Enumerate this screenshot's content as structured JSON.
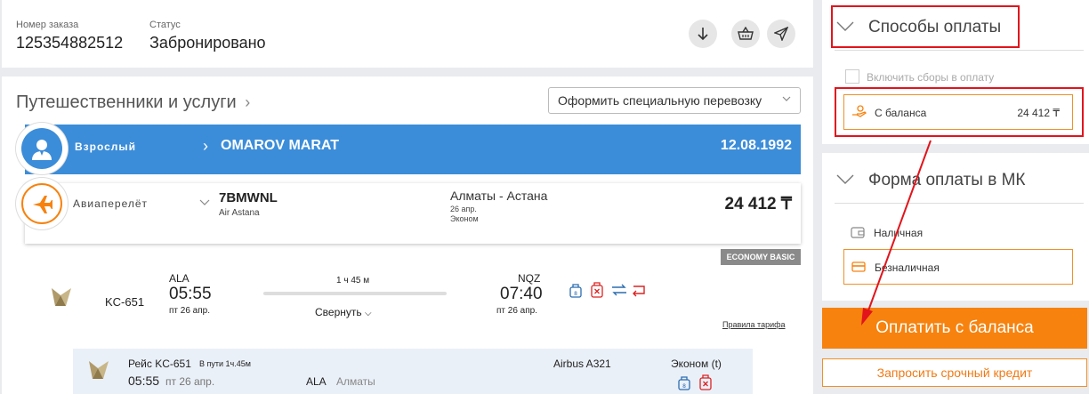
{
  "order": {
    "number_label": "Номер заказа",
    "number": "125354882512",
    "status_label": "Статус",
    "status": "Забронировано"
  },
  "travellers": {
    "title": "Путешественники и услуги",
    "special_transport": "Оформить специальную перевозку",
    "passenger": {
      "type": "Взрослый",
      "name": "OMAROV MARAT",
      "birthdate": "12.08.1992"
    },
    "flight": {
      "service": "Авиаперелёт",
      "pnr": "7BMWNL",
      "airline": "Air Astana",
      "route": "Алматы - Астана",
      "date": "26 апр.",
      "class": "Эконом",
      "price": "24 412 ₸",
      "fare_badge": "ECONOMY BASIC"
    },
    "segment": {
      "flight_no": "KC-651",
      "dep_code": "ALA",
      "dep_time": "05:55",
      "dep_date": "пт 26 апр.",
      "duration": "1 ч 45 м",
      "collapse": "Свернуть",
      "arr_code": "NQZ",
      "arr_time": "07:40",
      "arr_date": "пт 26 апр.",
      "fare_rules": "Правила тарифа"
    },
    "details": {
      "flight": "Рейс KC-651",
      "in_transit": "В пути 1ч.45м",
      "time": "05:55",
      "date": "пт 26 апр.",
      "code": "ALA",
      "city": "Алматы",
      "aircraft": "Airbus A321",
      "class": "Эконом (t)"
    }
  },
  "payment_methods": {
    "title": "Способы оплаты",
    "include_fees": "Включить сборы в оплату",
    "balance_label": "С баланса",
    "balance_amount": "24 412 ₸"
  },
  "payment_form": {
    "title": "Форма оплаты в МК",
    "cash": "Наличная",
    "cashless": "Безналичная"
  },
  "actions": {
    "pay": "Оплатить с баланса",
    "credit": "Запросить срочный кредит"
  },
  "colors": {
    "accent_orange": "#f7820e",
    "pax_blue": "#3b8dd9",
    "highlight_red": "#e2141c"
  }
}
